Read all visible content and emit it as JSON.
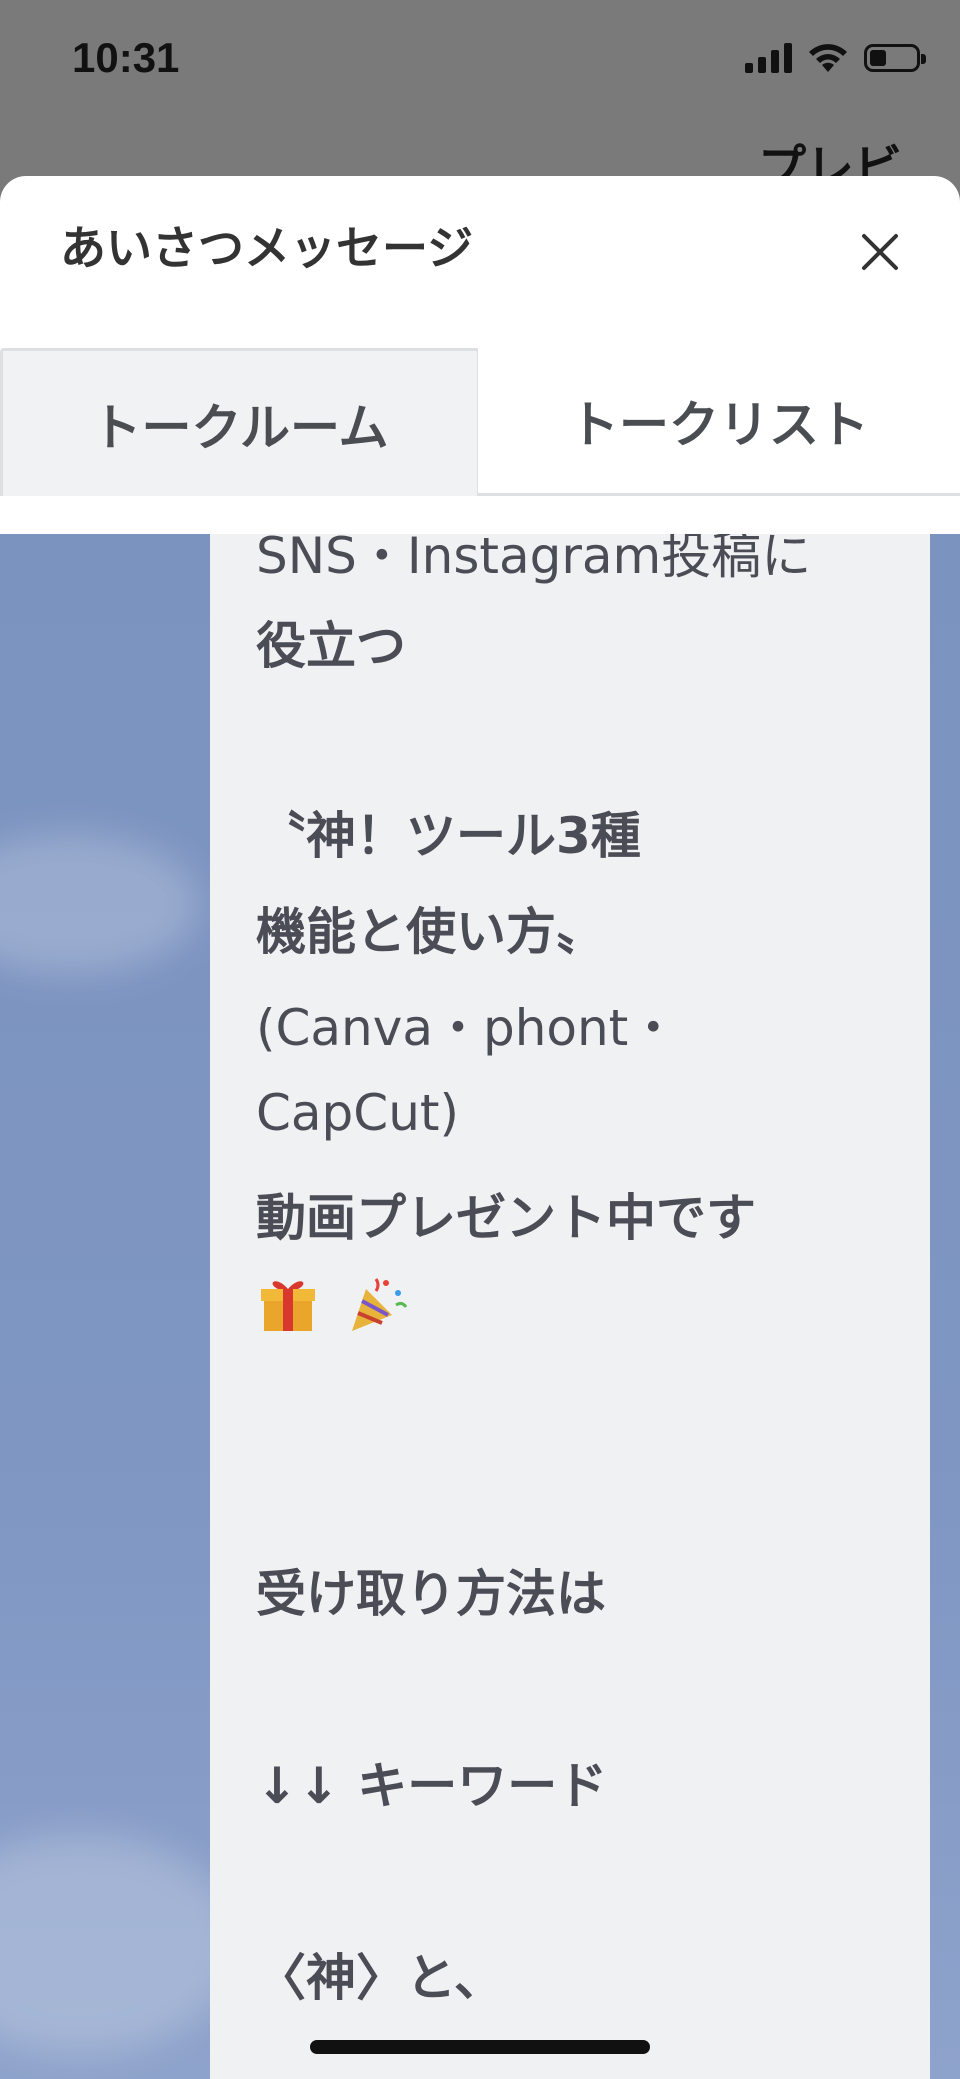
{
  "status": {
    "time": "10:31"
  },
  "background": {
    "title_peek": "プレビ"
  },
  "sheet": {
    "title": "あいさつメッセージ",
    "close_label": "×"
  },
  "tabs": [
    {
      "label": "トークルーム",
      "active": true
    },
    {
      "label": "トークリスト",
      "active": false
    }
  ],
  "message": {
    "lines": [
      "SNS・Instagram投稿に",
      "役立つ",
      "〝神！ツール3種",
      "機能と使い方〟",
      "(Canva・phont・",
      "CapCut)",
      "動画プレゼント中です",
      "受け取り方法は",
      "↓↓ キーワード",
      "〈神〉と、"
    ],
    "emojis": [
      "gift-emoji",
      "party-popper-emoji"
    ]
  }
}
